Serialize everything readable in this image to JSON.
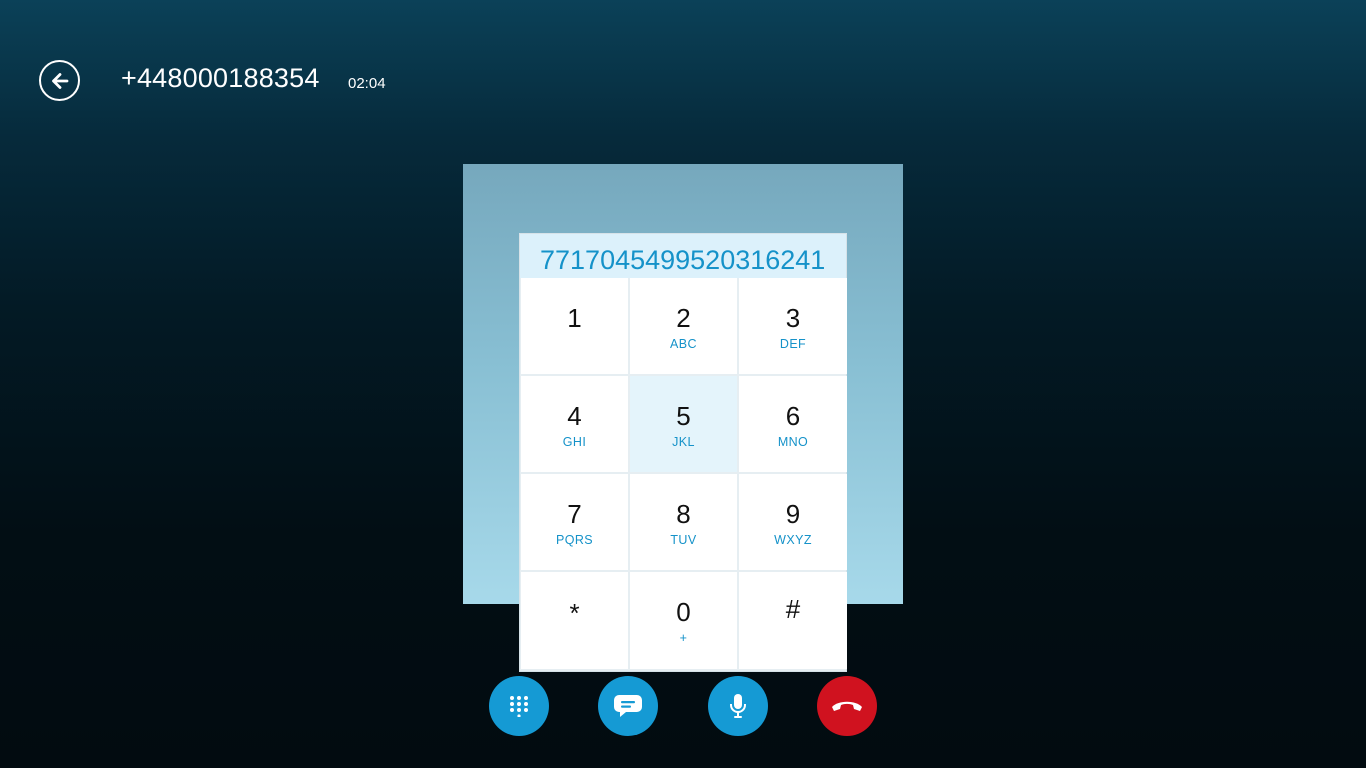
{
  "header": {
    "caller_number": "+448000188354",
    "call_duration": "02:04"
  },
  "dialpad": {
    "entered_digits": "7717045499520316241",
    "keys": [
      {
        "digit": "1",
        "letters": ""
      },
      {
        "digit": "2",
        "letters": "ABC"
      },
      {
        "digit": "3",
        "letters": "DEF"
      },
      {
        "digit": "4",
        "letters": "GHI"
      },
      {
        "digit": "5",
        "letters": "JKL"
      },
      {
        "digit": "6",
        "letters": "MNO"
      },
      {
        "digit": "7",
        "letters": "PQRS"
      },
      {
        "digit": "8",
        "letters": "TUV"
      },
      {
        "digit": "9",
        "letters": "WXYZ"
      },
      {
        "digit": "*",
        "letters": ""
      },
      {
        "digit": "0",
        "letters": "+"
      },
      {
        "digit": "#",
        "letters": ""
      }
    ]
  },
  "icons": {
    "back": "back-arrow-icon",
    "dialpad": "dialpad-icon",
    "chat": "chat-icon",
    "microphone": "microphone-icon",
    "hang_up": "hang-up-icon"
  },
  "colors": {
    "accent": "#159ad4",
    "end_call": "#d0121f",
    "digit_display": "#1592c9"
  }
}
